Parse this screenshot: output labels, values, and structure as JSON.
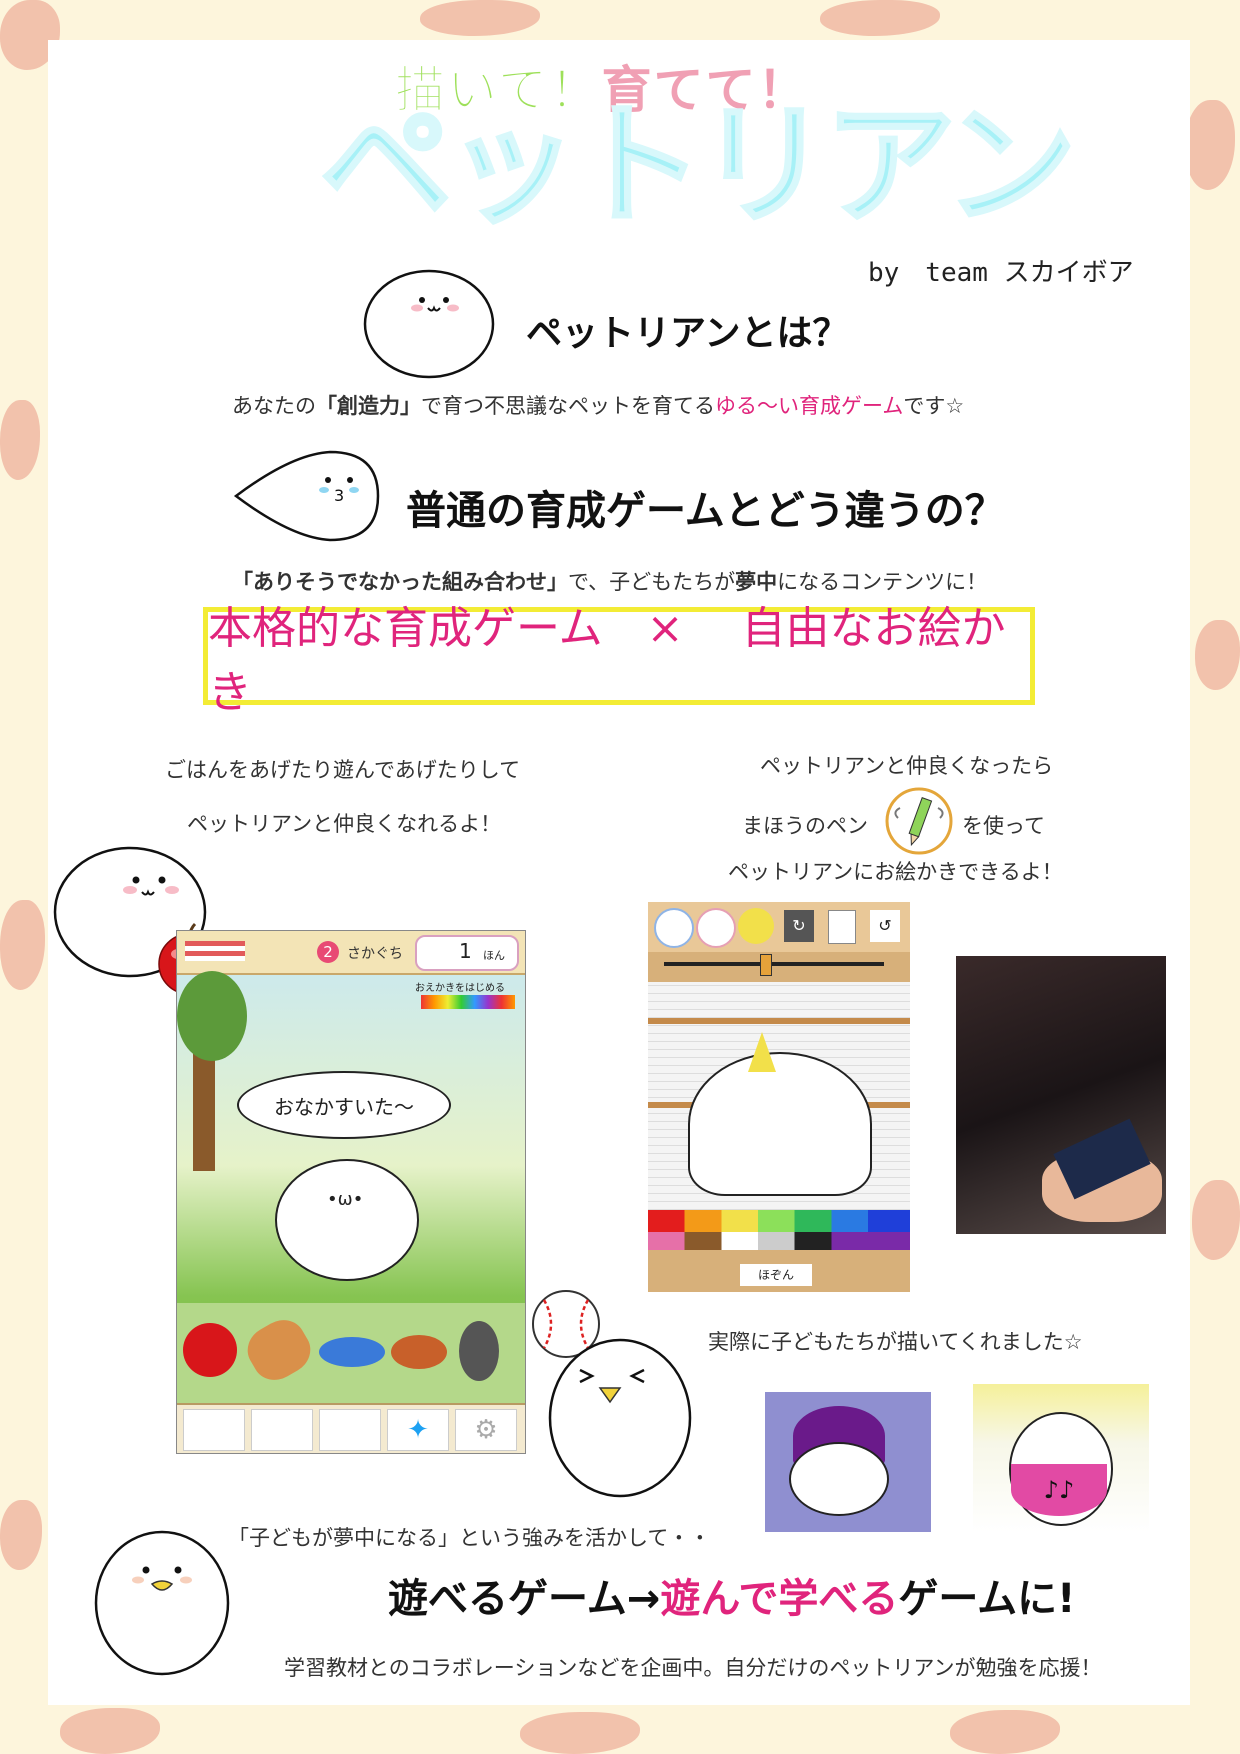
{
  "title_line1_a": "描いて！",
  "title_line1_b": "育てて！",
  "title_main": "ペットリアン",
  "byline": "by　team スカイボア",
  "section1": {
    "heading": "ペットリアンとは？",
    "text_a": "あなたの",
    "text_b": "「創造力」",
    "text_c": "で育つ不思議なペットを育てる",
    "text_d": "ゆる〜い育成ゲーム",
    "text_e": "です☆"
  },
  "section2": {
    "heading": "普通の育成ゲームとどう違うの？",
    "text_a": "「ありそうでなかった組み合わせ」",
    "text_b": "で、子どもたちが",
    "text_c": "夢中",
    "text_d": "になるコンテンツに！"
  },
  "highlight": "本格的な育成ゲーム　×　 自由なお絵かき",
  "left_caption": [
    "ごはんをあげたり遊んであげたりして",
    "ペットリアンと仲良くなれるよ！"
  ],
  "right_caption": {
    "line1": "ペットリアンと仲良くなったら",
    "line2a": "まほうのペン",
    "line2b": "を使って",
    "line3": "ペットリアンにお絵かきできるよ！"
  },
  "game_screen": {
    "counter": "2",
    "name": "さかぐち",
    "pen_count": "1",
    "pen_unit": "ほん",
    "draw_prompt": "おえかきをはじめる",
    "speech": "おなかすいた〜"
  },
  "draw_screen": {
    "done_button": "ほぞん"
  },
  "kids_caption": "実際に子どもたちが描いてくれました☆",
  "bottom": {
    "lead": "「子どもが夢中になる」という強みを活かして・・",
    "slogan_a": "遊べるゲーム→",
    "slogan_b": "遊んで学べる",
    "slogan_c": "ゲームに!",
    "footer": "学習教材とのコラボレーションなどを企画中。自分だけのペットリアンが勉強を応援！"
  },
  "colors": {
    "accent_pink": "#e0247c",
    "title_cyan": "#a7f1f7",
    "title_green": "#9ee05a",
    "box_yellow": "#f3ec35"
  }
}
